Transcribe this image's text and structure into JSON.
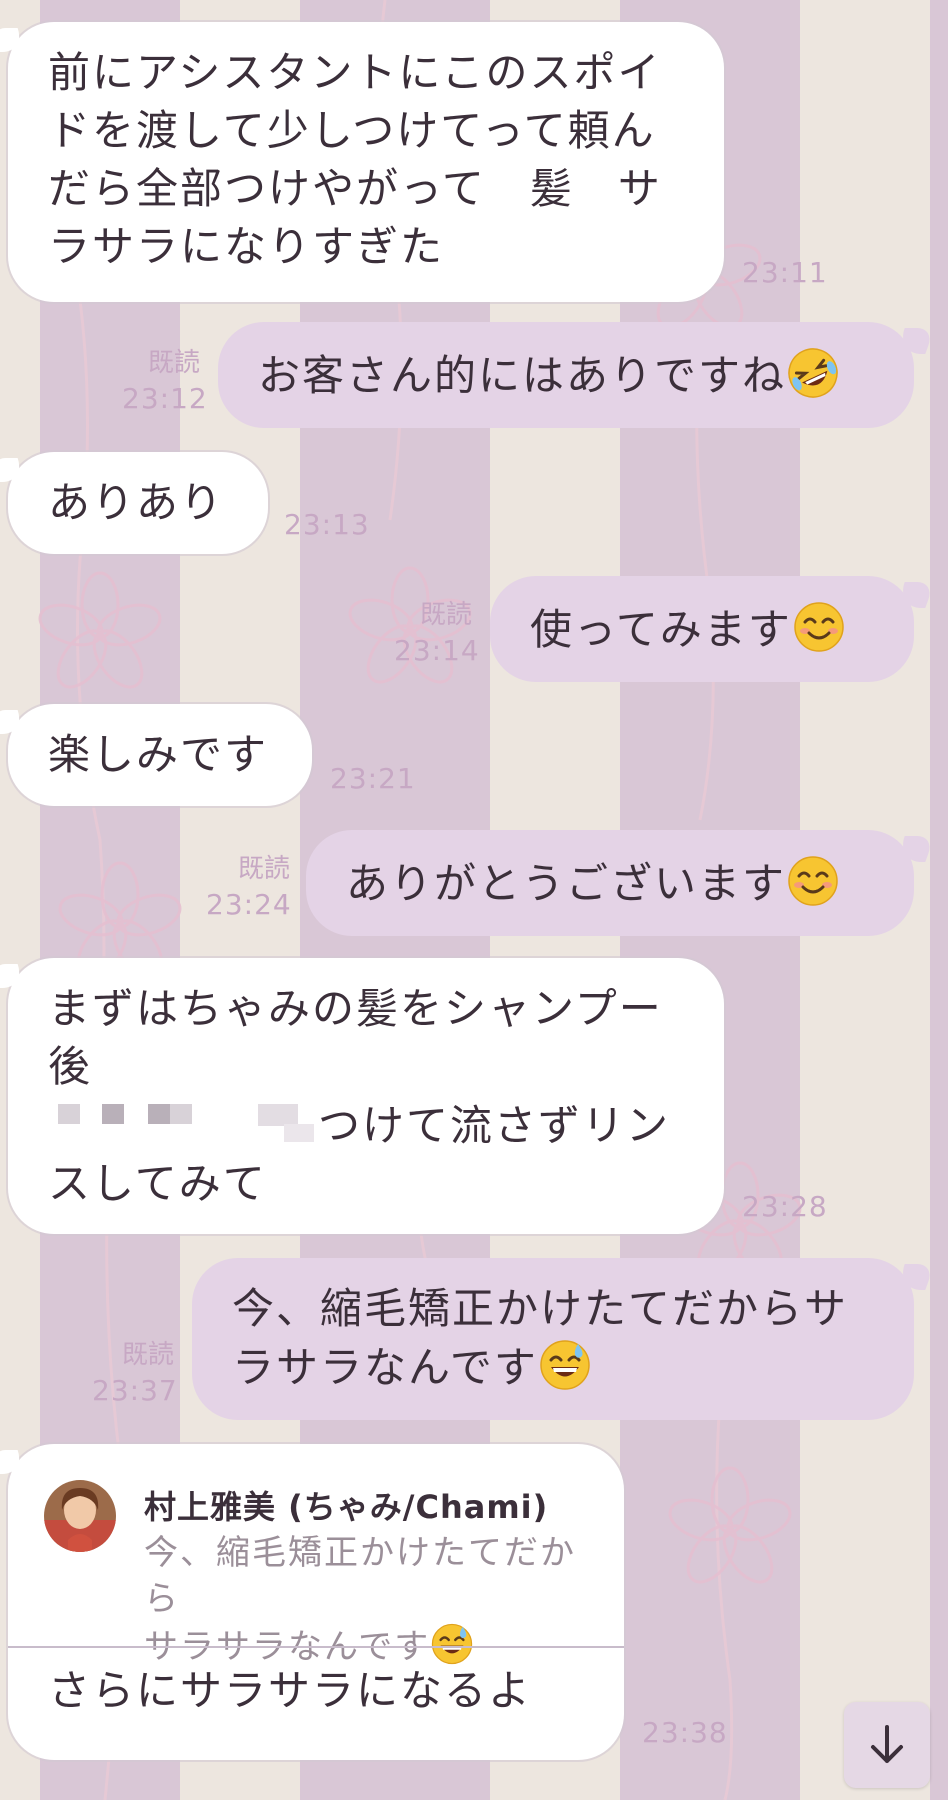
{
  "messages": [
    {
      "id": "m1",
      "type": "incoming",
      "lines": [
        "前にアシスタントにこのスポイ",
        "ドを渡して少しつけてって頼ん",
        "だら全部つけやがって　髪　サ",
        "ラサラになりすぎた"
      ],
      "time": "23:11"
    },
    {
      "id": "m2",
      "type": "outgoing",
      "text": "お客さん的にはありですね",
      "emoji": "rolling-on-floor-laughing-emoji",
      "read": "既読",
      "time": "23:12"
    },
    {
      "id": "m3",
      "type": "incoming",
      "text": "ありあり",
      "time": "23:13"
    },
    {
      "id": "m4",
      "type": "outgoing",
      "text": "使ってみます",
      "emoji": "smiling-face-emoji",
      "read": "既読",
      "time": "23:14"
    },
    {
      "id": "m5",
      "type": "incoming",
      "text": "楽しみです",
      "time": "23:21"
    },
    {
      "id": "m6",
      "type": "outgoing",
      "text": "ありがとうございます",
      "emoji": "smiling-face-emoji",
      "read": "既読",
      "time": "23:24"
    },
    {
      "id": "m7",
      "type": "incoming",
      "lines": [
        "まずはちゃみの髪をシャンプー",
        "後",
        "つけて流さずリン",
        "スしてみて"
      ],
      "time": "23:28"
    },
    {
      "id": "m8",
      "type": "outgoing",
      "lines": [
        "今、縮毛矯正かけたてだからサ",
        "ラサラなんです"
      ],
      "emoji": "grinning-sweat-emoji",
      "read": "既読",
      "time": "23:37"
    },
    {
      "id": "m9",
      "type": "incoming-reply",
      "reply_name": "村上雅美 (ちゃみ/Chami)",
      "reply_lines": [
        "今、縮毛矯正かけたてだから",
        "サラサラなんです"
      ],
      "text": "さらにサラサラになるよ",
      "time": "23:38"
    }
  ],
  "controls": {
    "scroll_down_icon": "arrow-down-icon"
  },
  "colors": {
    "incoming_bubble": "#ffffff",
    "outgoing_bubble": "#e4d3e6",
    "text": "#3b2f3a",
    "timestamp": "#c7a8c4"
  }
}
